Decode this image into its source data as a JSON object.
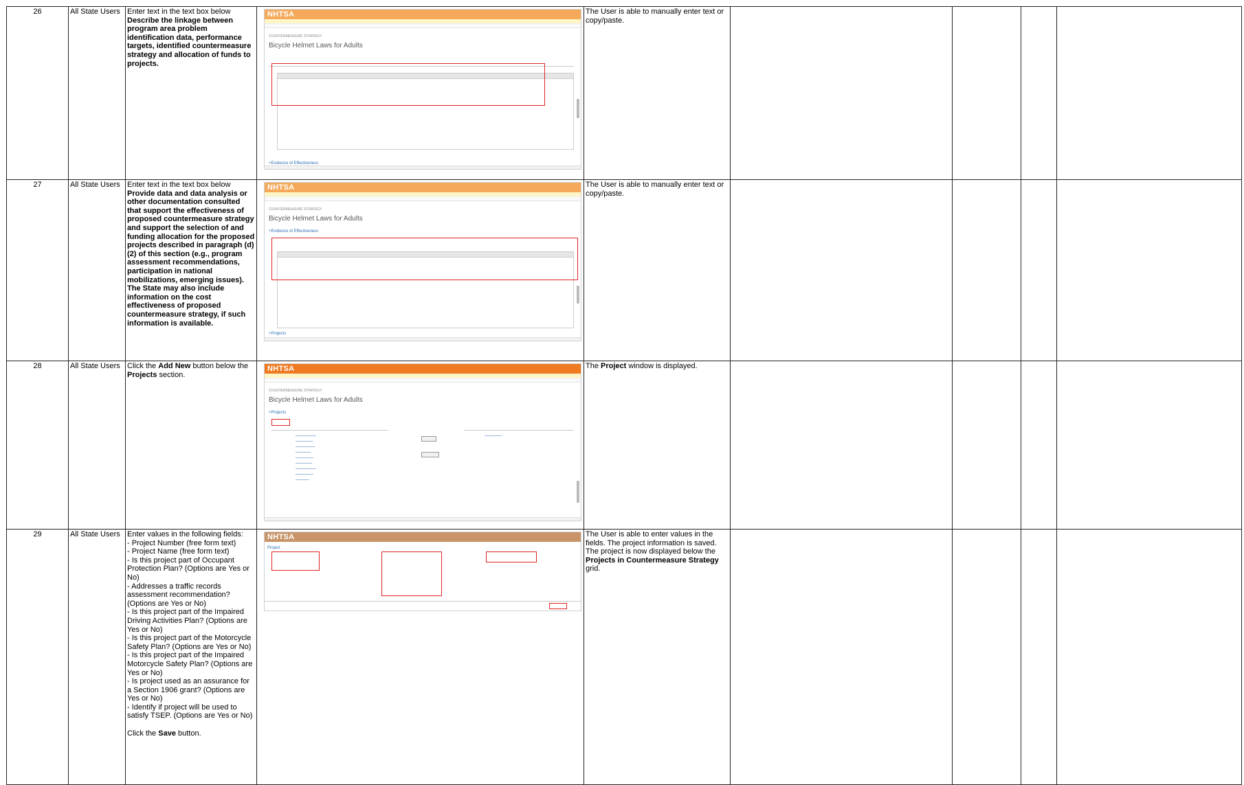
{
  "rows": [
    {
      "num": "26",
      "user": "All State Users",
      "step_text": [
        {
          "t": "Enter text in the text box below",
          "b": false
        },
        {
          "t": "Describe the linkage between program area problem identification data, performance targets, identified countermeasure strategy and allocation of funds to projects.",
          "b": true
        }
      ],
      "screenshot": {
        "app": "NHTSA",
        "title": "Bicycle Helmet Laws for Adults",
        "section": "Evidence of Effectiveness"
      },
      "result_text": [
        {
          "t": "The User is able to manually enter text or copy/paste.",
          "b": false
        }
      ]
    },
    {
      "num": "27",
      "user": "All State Users",
      "step_text": [
        {
          "t": "Enter text in the text box below",
          "b": false
        },
        {
          "t": "Provide data and data analysis or other documentation consulted that support the effectiveness of proposed countermeasure strategy and support the selection of and funding allocation for the proposed projects described in paragraph (d)(2) of this section (e.g., program assessment recommendations, participation in national mobilizations, emerging issues). The State may also include information on the cost effectiveness of proposed countermeasure strategy, if such information is available.",
          "b": true
        }
      ],
      "screenshot": {
        "app": "NHTSA",
        "title": "Bicycle Helmet Laws for Adults",
        "section": "Evidence of Effectiveness",
        "section2": "Projects"
      },
      "result_text": [
        {
          "t": "The User is able to manually enter text or copy/paste.",
          "b": false
        }
      ]
    },
    {
      "num": "28",
      "user": "All State Users",
      "step_text": [
        {
          "t": "Click the ",
          "b": false
        },
        {
          "t": "Add New",
          "b": true
        },
        {
          "t": " button below the ",
          "b": false
        },
        {
          "t": "Projects",
          "b": true
        },
        {
          "t": " section.",
          "b": false
        }
      ],
      "screenshot": {
        "app": "NHTSA",
        "title": "Bicycle Helmet Laws for Adults",
        "section": "Projects"
      },
      "result_text": [
        {
          "t": "The ",
          "b": false
        },
        {
          "t": "Project",
          "b": true
        },
        {
          "t": " window is displayed.",
          "b": false
        }
      ]
    },
    {
      "num": "29",
      "user": "All State Users",
      "step_text": [
        {
          "t": "Enter values in the following fields:\n- Project Number (free form text)\n- Project Name (free form text)\n- Is this project part of Occupant Protection Plan? (Options are Yes or No)\n- Addresses a traffic records assessment recommendation? (Options are Yes or No)\n- Is this project part of the Impaired Driving Activities Plan? (Options are Yes or No)\n- Is this project part of the Motorcycle Safety Plan? (Options are Yes or No)\n- Is this project part of the Impaired Motorcycle Safety Plan? (Options are Yes or No)\n- Is project used as an assurance for a Section 1906 grant? (Options are Yes or No)\n- Identify if project will be used to satisfy TSEP. (Options are Yes or No)\n\nClick the ",
          "b": false
        },
        {
          "t": "Save",
          "b": true
        },
        {
          "t": " button.",
          "b": false
        }
      ],
      "screenshot": {
        "app": "NHTSA",
        "title": "Project"
      },
      "result_text": [
        {
          "t": "The User is able to enter values in the fields. The project information is saved. The project is now displayed below the ",
          "b": false
        },
        {
          "t": "Projects in Countermeasure Strategy",
          "b": true
        },
        {
          "t": " grid.",
          "b": false
        }
      ]
    }
  ]
}
